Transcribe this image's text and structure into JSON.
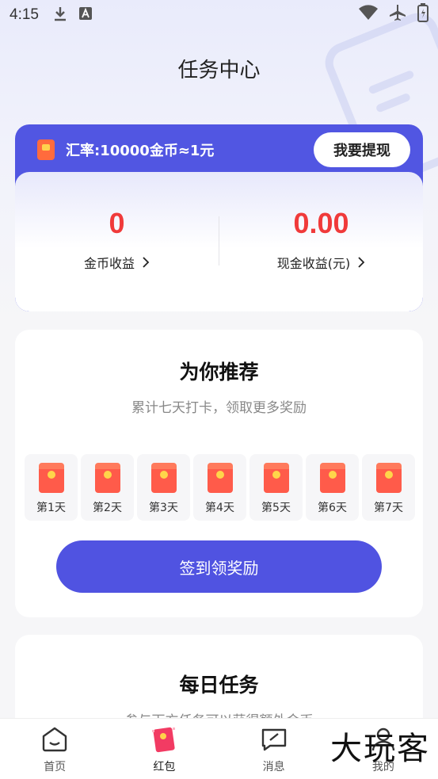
{
  "status_bar": {
    "time": "4:15",
    "icons": [
      "download-icon",
      "text-a-icon",
      "wifi-icon",
      "airplane-icon",
      "battery-icon"
    ]
  },
  "header": {
    "title": "任务中心"
  },
  "exchange": {
    "rate_text": "汇率:10000金币≈1元",
    "withdraw_label": "我要提现",
    "coin_value": "0",
    "coin_label": "金币收益",
    "cash_value": "0.00",
    "cash_label": "现金收益(元)",
    "accent_color": "#5156e2",
    "value_color": "#f03a3a"
  },
  "recommend": {
    "title": "为你推荐",
    "subtitle": "累计七天打卡，领取更多奖励",
    "days": [
      "第1天",
      "第2天",
      "第3天",
      "第4天",
      "第5天",
      "第6天",
      "第7天"
    ],
    "checkin_label": "签到领奖励"
  },
  "daily": {
    "title": "每日任务",
    "subtitle": "参与下方任务可以获得额外金币"
  },
  "bottom_nav": {
    "items": [
      {
        "label": "首页",
        "icon": "home-icon"
      },
      {
        "label": "红包",
        "icon": "red-envelope-icon"
      },
      {
        "label": "消息",
        "icon": "message-icon"
      },
      {
        "label": "我的",
        "icon": "profile-icon"
      }
    ]
  },
  "watermark": "大玩客"
}
